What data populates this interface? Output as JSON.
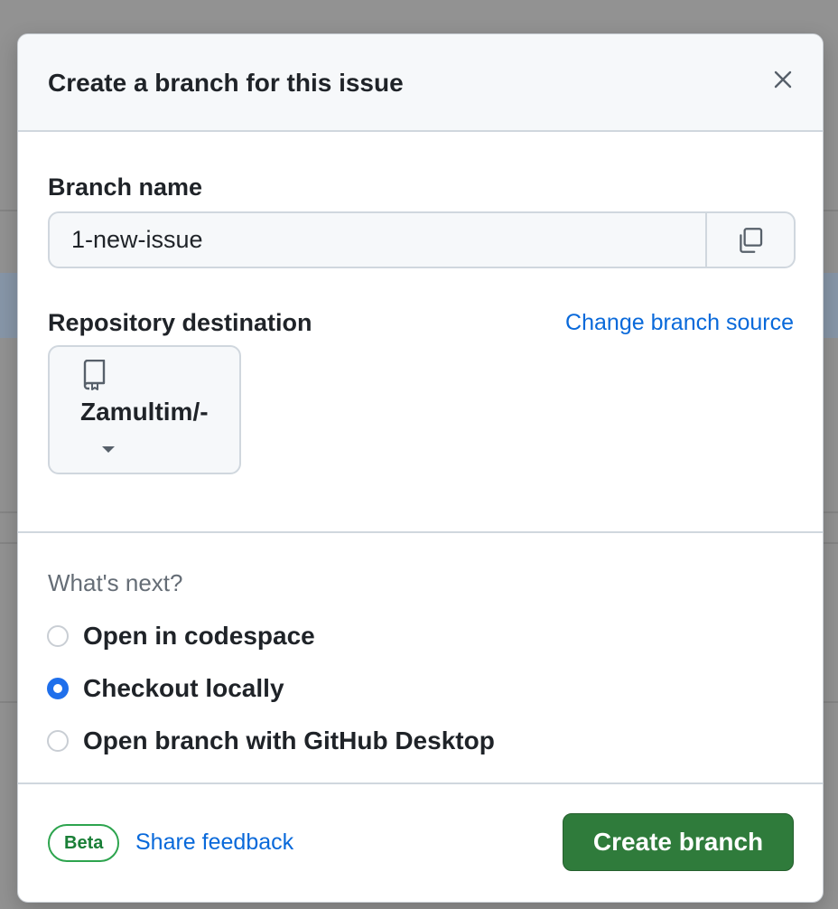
{
  "dialog": {
    "title": "Create a branch for this issue",
    "close_icon": "close-icon"
  },
  "branch": {
    "label": "Branch name",
    "value": "1-new-issue",
    "copy_icon": "copy-icon"
  },
  "repository": {
    "label": "Repository destination",
    "change_source_link": "Change branch source",
    "selected": "Zamultim/-",
    "repo_icon": "repo-icon",
    "caret_icon": "chevron-down-icon"
  },
  "next": {
    "label": "What's next?",
    "options": [
      {
        "label": "Open in codespace",
        "checked": false
      },
      {
        "label": "Checkout locally",
        "checked": true
      },
      {
        "label": "Open branch with GitHub Desktop",
        "checked": false
      }
    ]
  },
  "footer": {
    "badge": "Beta",
    "feedback_link": "Share feedback",
    "create_button": "Create branch"
  },
  "colors": {
    "primary_button": "#2f7b3b",
    "link": "#0969da",
    "radio_selected": "#1f6feb",
    "badge": "#1a7f37"
  }
}
